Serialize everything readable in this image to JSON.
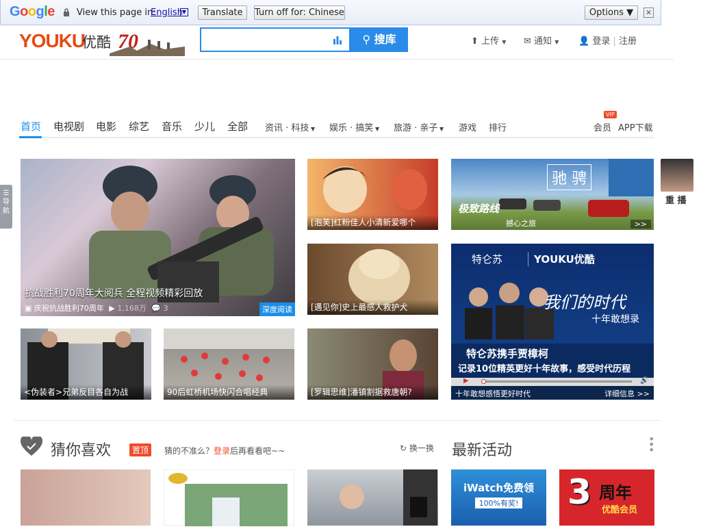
{
  "translate_bar": {
    "brand": "Google",
    "prompt": "View this page in:",
    "language": "English",
    "translate_label": "Translate",
    "turn_off_label": "Turn off for: Chinese",
    "options_label": "Options ▼",
    "close_label": "✕"
  },
  "header": {
    "logo": "YOUKU",
    "logo_cn": "优酷",
    "search_button": "搜库",
    "upload": "上传",
    "notify": "通知",
    "login": "登录",
    "register": "注册",
    "separator": "|"
  },
  "nav": {
    "items": [
      "首页",
      "电视剧",
      "电影",
      "综艺",
      "音乐",
      "少儿",
      "全部"
    ],
    "secondary": [
      "资讯 · 科技",
      "娱乐 · 搞笑",
      "旅游 · 亲子",
      "游戏",
      "排行"
    ],
    "vip_badge": "VIP",
    "member": "会员",
    "app": "APP下载"
  },
  "side_nav": {
    "label_1": "导",
    "label_2": "航"
  },
  "featured": {
    "title": "抗战胜利70周年大阅兵 全程视频精彩回放",
    "tag": "深度阅读",
    "channel": "庆祝抗战胜利70周年",
    "plays": "1,168万",
    "comments": "3"
  },
  "tiles": {
    "t1": "[泡芙]红粉佳人小清新爱哪个",
    "t2": "[遇见你]史上最感人救护犬",
    "t3": "<伪装者>兄弟反目各自为战",
    "t4": "90后虹桥机场快闪合唱经典",
    "t5": "[罗辑思维]潘镇割据救唐朝?",
    "t6_title": "驰 骋",
    "t6_caption": "撼心之旅",
    "t6_slogan": "极致路线",
    "t6_arrow": ">>",
    "ad_brand": "特仑苏",
    "ad_logo": "YOUKU优酷",
    "ad_headline": "我们的时代",
    "ad_sub": "十年敢想录",
    "ad_line1": "特仑苏携手贾樟柯",
    "ad_line2": "记录10位精英更好十年故事，感受时代历程",
    "ad_caption": "十年敢想感悟更好时代",
    "ad_more": "详细信息 >>",
    "replay_label": "重 播"
  },
  "section": {
    "guess_title": "猜你喜欢",
    "pin": "置顶",
    "hint_pre": "猜的不准么？",
    "hint_link": "登录",
    "hint_post": "后再看看吧~~",
    "refresh": "换一换",
    "activity_title": "最新活动",
    "promo1_title": "iWatch免费领",
    "promo1_sub": "100%有奖!",
    "promo2_number": "3",
    "promo2_title": "周年",
    "promo2_sub": "优酷会员"
  },
  "colors": {
    "accent": "#1d8ee8",
    "brand": "#e84a12",
    "search": "#2a8be8"
  }
}
